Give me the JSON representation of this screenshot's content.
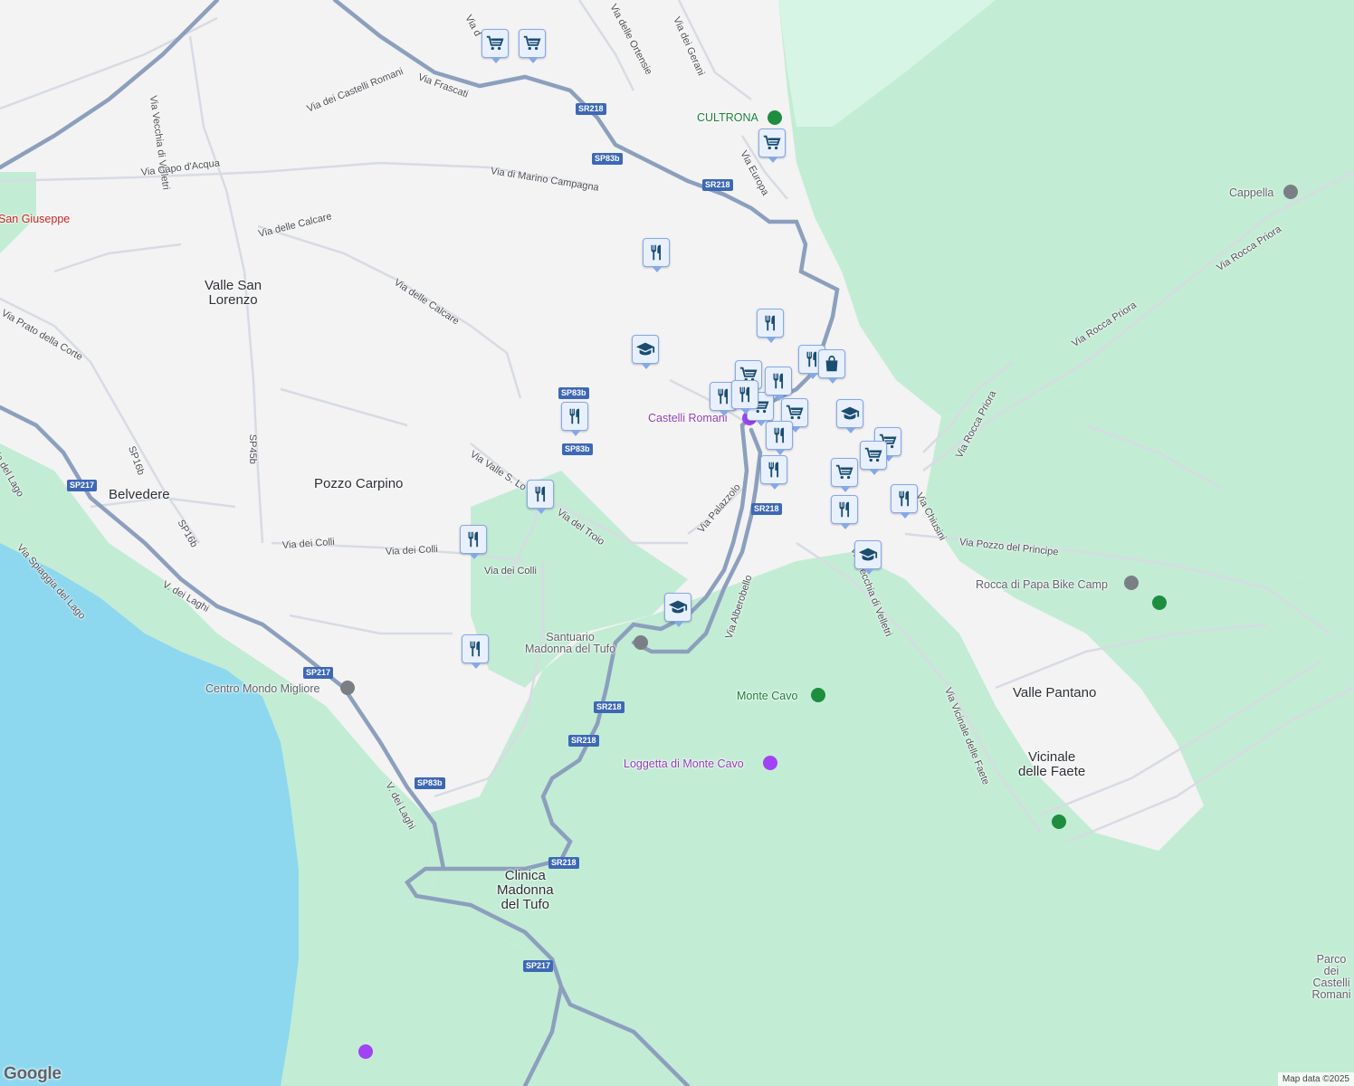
{
  "map": {
    "colors": {
      "background": "#f3f3f4",
      "park": "#c3ecd5",
      "park_light": "#d6f5e4",
      "water": "#8ed8ef",
      "highway": "#8c9fbd",
      "road": "#d7dbe2",
      "shield": "#3d68b5",
      "pin_fill": "#e8f0fe",
      "pin_stroke": "#86a8e6",
      "pin_icon": "#1a4d6e"
    },
    "areas": {
      "valle_san_lorenzo": "Valle San\nLorenzo",
      "belvedere": "Belvedere",
      "pozzo_carpino": "Pozzo Carpino",
      "valle_pantano": "Valle Pantano",
      "vicinale_delle_faete": "Vicinale\ndelle Faete",
      "clinica_madonna_del_tufo": "Clinica\nMadonna\ndel Tufo"
    },
    "streets": {
      "via_frascati": "Via Frascati",
      "via_dei_castelli_romani": "Via dei Castelli Romani",
      "via_vecchia_di_velletri": "Via Vecchia di Velletri",
      "via_capo_dacqua": "Via Capo d'Acqua",
      "via_di_marino_campagna": "Via di Marino Campagna",
      "via_delle_calcare_1": "Via delle Calcare",
      "via_delle_calcare_2": "Via delle Calcare",
      "via_prato_della_corte": "Via Prato della Corte",
      "via_del_lago": "Via del Lago",
      "via_spiaggia_del_lago": "Via Spiaggia del Lago",
      "v_dei_laghi_1": "V. dei Laghi",
      "v_dei_laghi_2": "V. dei Laghi",
      "via_dei_colli_1": "Via dei Colli",
      "via_dei_colli_2": "Via dei Colli",
      "via_dei_colli_3": "Via dei Colli",
      "via_valle_s_lo": "Via Valle S. Lo",
      "via_del_troio": "Via del Troio",
      "via_palazzolo": "Via Palazzolo",
      "via_aberobello": "Via Alberobello",
      "via_vecchia_di_velletri_2": "Via Vecchia di Velletri",
      "via_vicinale_delle_faete": "Via Vicinale delle Faete",
      "via_pozzo_del_principe": "Via Pozzo del Principe",
      "via_chiusini": "Via Chiusini",
      "via_rocca_priora_1": "Via Rocca Priora",
      "via_rocca_priora_2": "Via Rocca Priora",
      "via_rocca_priora_3": "Via Rocca Priora",
      "via_europa": "Via Europa",
      "via_dei_gerani": "Via dei Gerani",
      "via_ortensie": "Via delle Ortensie",
      "via_d": "Via d"
    },
    "shields": {
      "sr218_a": "SR218",
      "sp83b_a": "SP83b",
      "sr218_b": "SR218",
      "sp83b_b": "SP83b",
      "sp83b_c": "SP83b",
      "sp217_a": "SP217",
      "sr218_c": "SR218",
      "sp217_b": "SP217",
      "sr218_d": "SR218",
      "sr218_e": "SR218",
      "sp83b_d": "SP83b",
      "sr218_f": "SR218",
      "sp217_c": "SP217"
    },
    "roadnums": {
      "sp45b": "SP45b",
      "sp16b_a": "SP16b",
      "sp16b_b": "SP16b"
    },
    "pois": {
      "cultrona": "CULTRONA",
      "cappella": "Cappella",
      "san_giuseppe": "San Giuseppe",
      "castelli_romani": "Castelli Romani",
      "santuario": "Santuario\nMadonna del Tufo",
      "centro_mondo_migliore": "Centro Mondo Migliore",
      "monte_cavo": "Monte Cavo",
      "loggetta": "Loggetta di Monte Cavo",
      "bike_camp": "Rocca di Papa Bike Camp",
      "parco": "Parco dei\nCastelli\nRomani"
    },
    "markers": [
      {
        "icon": "cart-icon"
      },
      {
        "icon": "cart-icon"
      },
      {
        "icon": "cart-icon"
      },
      {
        "icon": "cart-icon"
      },
      {
        "icon": "fork-knife-icon"
      },
      {
        "icon": "fork-knife-icon"
      },
      {
        "icon": "graduation-cap-icon"
      },
      {
        "icon": "fork-knife-icon"
      },
      {
        "icon": "shopping-bag-icon"
      },
      {
        "icon": "cart-icon"
      },
      {
        "icon": "fork-knife-icon"
      },
      {
        "icon": "graduation-cap-icon"
      },
      {
        "icon": "cart-icon"
      },
      {
        "icon": "fork-knife-icon"
      },
      {
        "icon": "graduation-cap-icon"
      },
      {
        "icon": "cart-icon"
      },
      {
        "icon": "cart-icon"
      },
      {
        "icon": "fork-knife-icon"
      },
      {
        "icon": "fork-knife-icon"
      },
      {
        "icon": "cart-icon"
      },
      {
        "icon": "fork-knife-icon"
      },
      {
        "icon": "fork-knife-icon"
      },
      {
        "icon": "fork-knife-icon"
      },
      {
        "icon": "graduation-cap-icon"
      },
      {
        "icon": "fork-knife-icon"
      },
      {
        "icon": "fork-knife-icon"
      },
      {
        "icon": "fork-knife-icon"
      },
      {
        "icon": "fork-knife-icon"
      }
    ],
    "attribution": {
      "logo": "Google",
      "data": "Map data ©2025"
    }
  }
}
